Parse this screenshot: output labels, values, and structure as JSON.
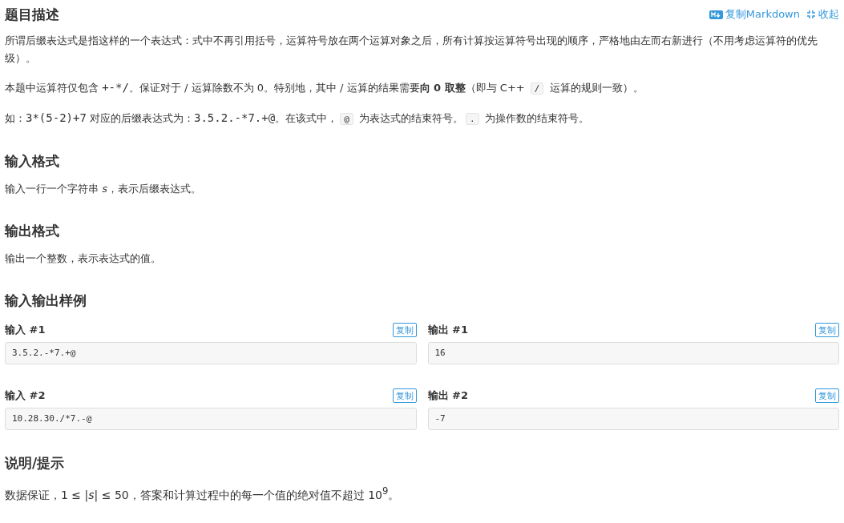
{
  "title": "题目描述",
  "actions": [
    {
      "kind": "markdown",
      "label": "复制Markdown"
    },
    {
      "kind": "collapse",
      "label": "收起"
    }
  ],
  "description": [
    [
      {
        "kind": "text",
        "text": "所谓后缀表达式是指这样的一个表达式：式中不再引用括号，运算符号放在两个运算对象之后，所有计算按运算符号出现的顺序，严格地由左而右新进行（不用考虑运算符的优先级）。"
      }
    ],
    [
      {
        "kind": "text",
        "text": "本题中运算符仅包含 "
      },
      {
        "kind": "mono",
        "text": "+-*/"
      },
      {
        "kind": "text",
        "text": "。保证对于 / 运算除数不为 0。特别地，其中 / 运算的结果需要**向 0 取整**（即与 C++ "
      },
      {
        "kind": "code",
        "text": "/"
      },
      {
        "kind": "text",
        "text": " 运算的规则一致）。"
      }
    ],
    [
      {
        "kind": "text",
        "text": "如："
      },
      {
        "kind": "mono",
        "text": "3*(5-2)+7"
      },
      {
        "kind": "text",
        "text": " 对应的后缀表达式为："
      },
      {
        "kind": "mono",
        "text": "3.5.2.-*7.+@"
      },
      {
        "kind": "text",
        "text": "。在该式中，"
      },
      {
        "kind": "code",
        "text": "@"
      },
      {
        "kind": "text",
        "text": " 为表达式的结束符号。"
      },
      {
        "kind": "code",
        "text": "."
      },
      {
        "kind": "text",
        "text": " 为操作数的结束符号。"
      }
    ]
  ],
  "sections": [
    {
      "heading": "输入格式",
      "paragraph": "输入一行一个字符串 *s*，表示后缀表达式。"
    },
    {
      "heading": "输出格式",
      "paragraph": "输出一个整数，表示表达式的值。"
    }
  ],
  "samples_heading": "输入输出样例",
  "samples": [
    {
      "input_label": "输入 #1",
      "input": "3.5.2.-*7.+@",
      "input_copy": "复制",
      "output_label": "输出 #1",
      "output": "16",
      "output_copy": "复制"
    },
    {
      "input_label": "输入 #2",
      "input": "10.28.30./*7.-@",
      "input_copy": "复制",
      "output_label": "输出 #2",
      "output": "-7",
      "output_copy": "复制"
    }
  ],
  "hint_heading": "说明/提示",
  "hint": "数据保证，1 ≤ |*s*| ≤ 50，答案和计算过程中的每一个值的绝对值不超过 10$^{9}$。"
}
